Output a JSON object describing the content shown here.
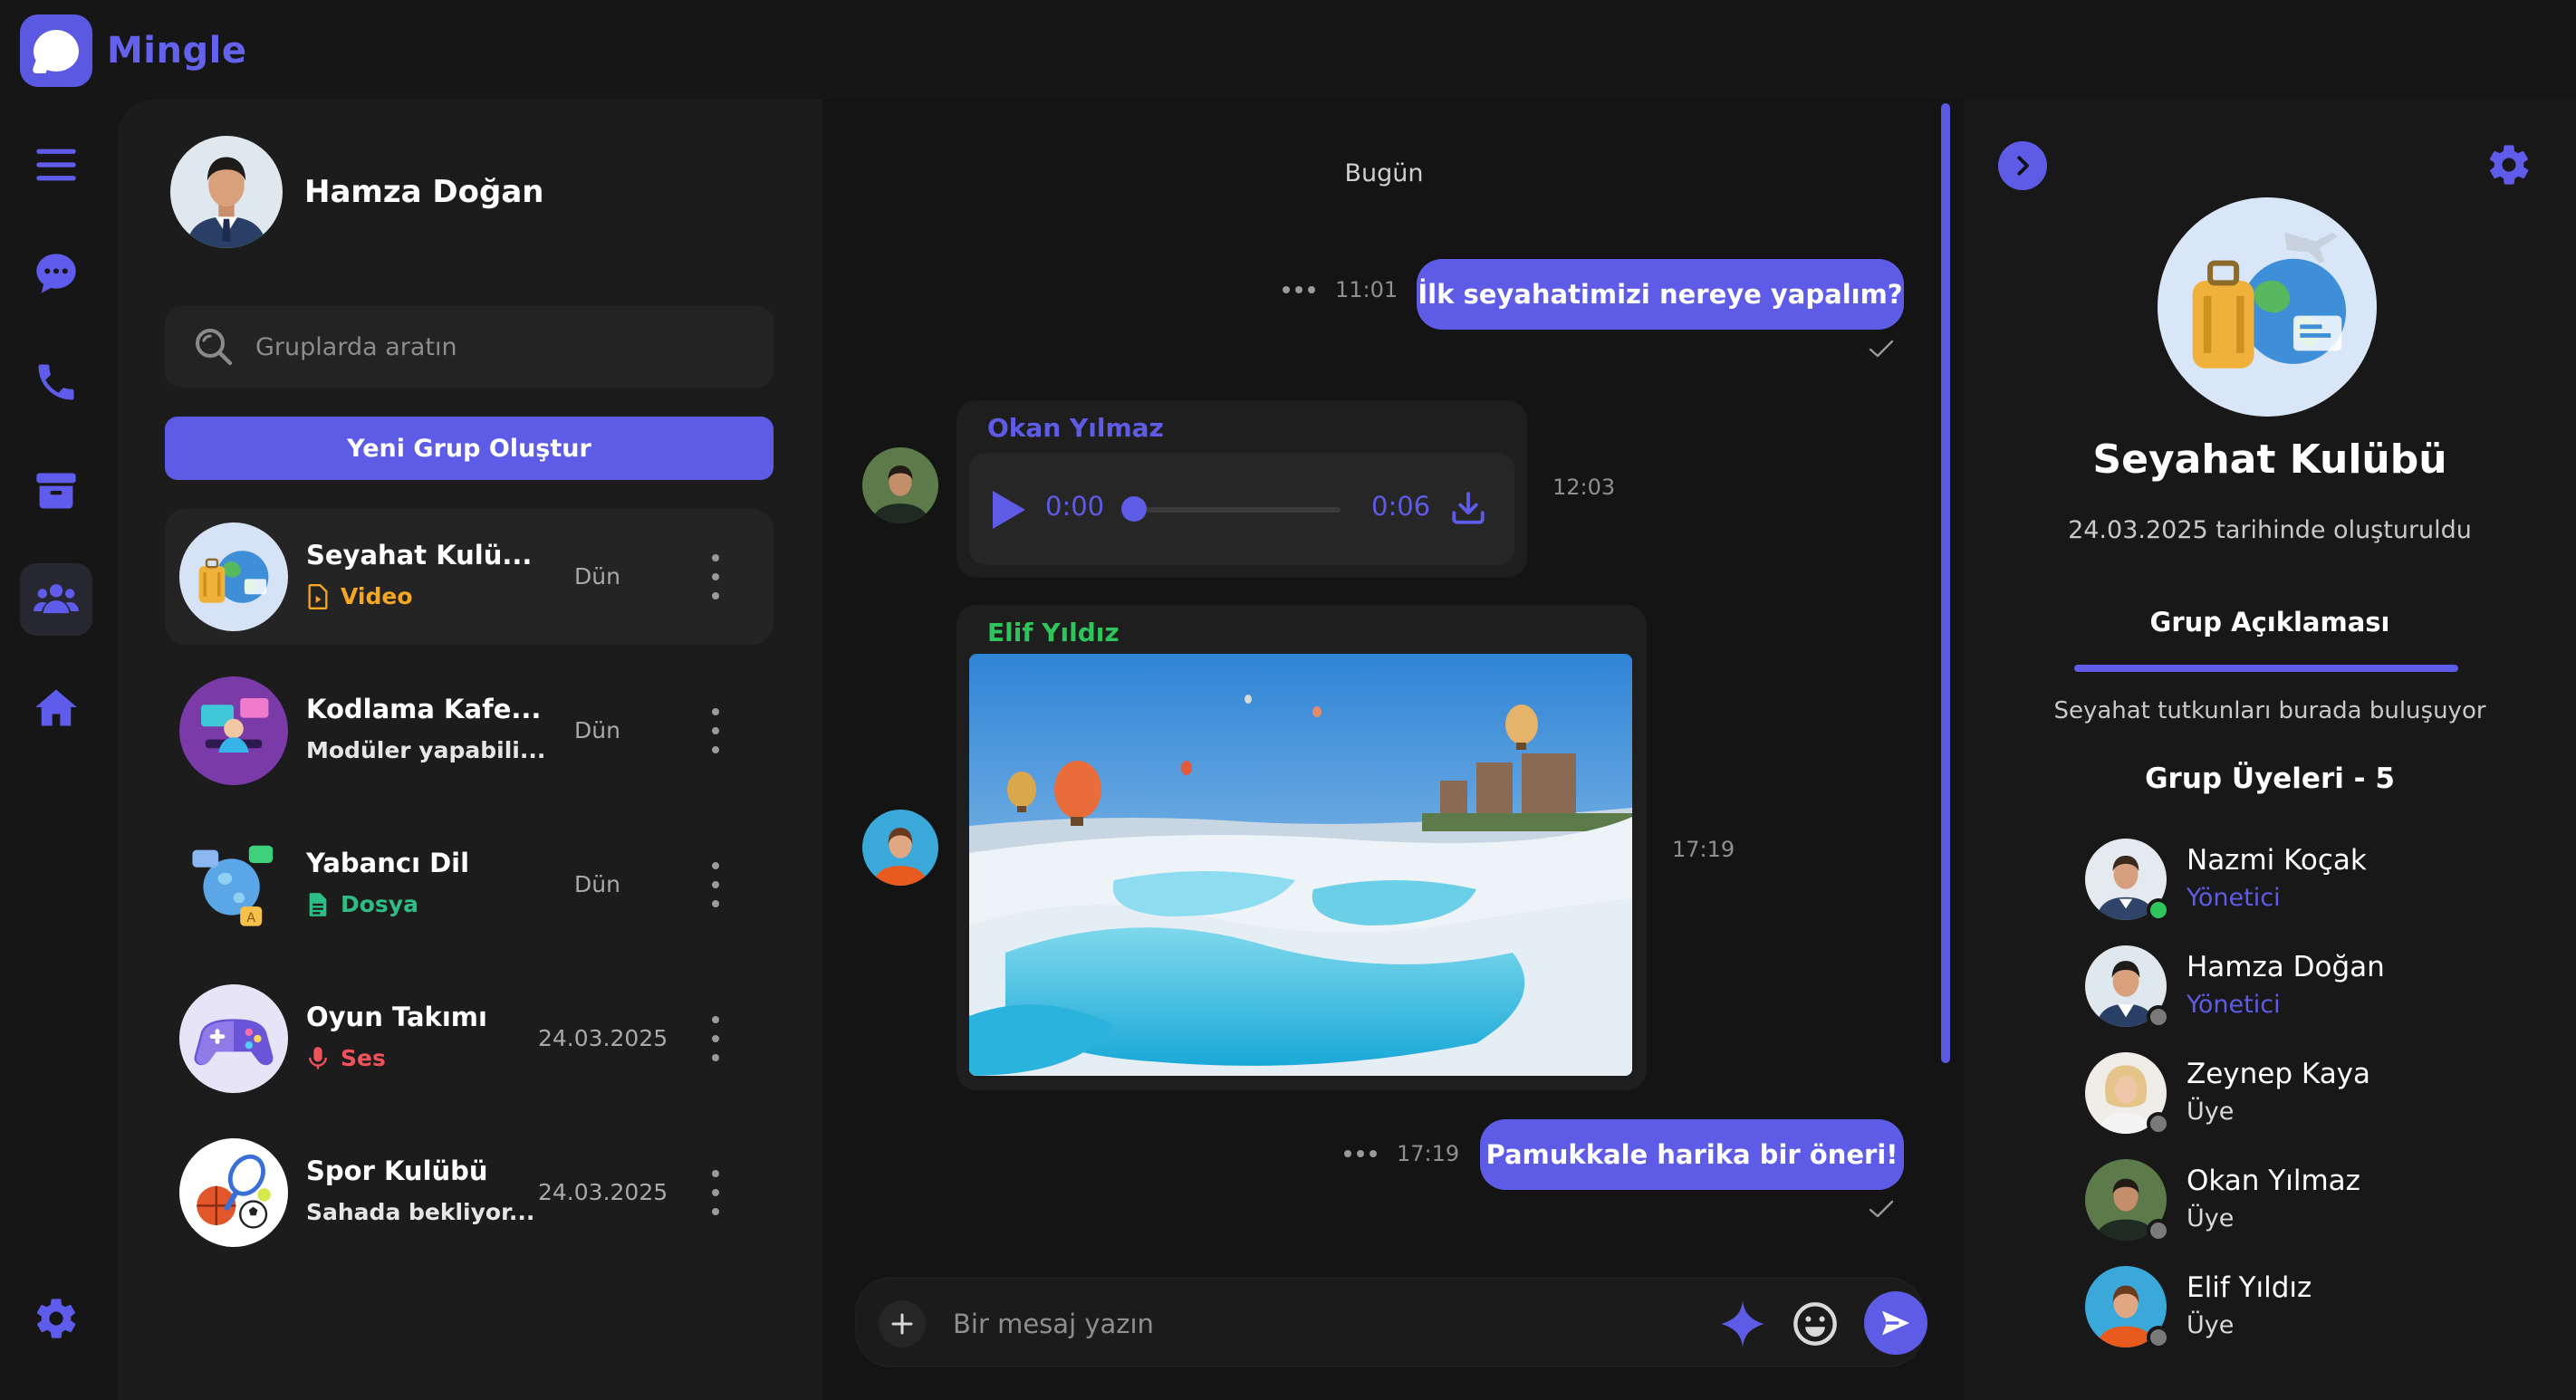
{
  "app": {
    "name": "Mingle",
    "accent": "#5e5ce6"
  },
  "rail": {
    "icons": [
      "menu-icon",
      "chat-icon",
      "phone-icon",
      "archive-icon",
      "groups-icon",
      "home-icon",
      "settings-icon"
    ],
    "active": "groups-icon"
  },
  "user": {
    "name": "Hamza Doğan"
  },
  "search": {
    "placeholder": "Gruplarda aratın"
  },
  "new_group_label": "Yeni Grup Oluştur",
  "groups": [
    {
      "name": "Seyahat Kulü...",
      "sub": "Video",
      "sub_icon": "video-file-icon",
      "sub_color": "#f5a623",
      "time": "Dün",
      "active": true
    },
    {
      "name": "Kodlama Kafe...",
      "sub": "Modüler yapabili...",
      "sub_icon": "",
      "sub_color": "#e6e6e6",
      "time": "Dün",
      "active": false
    },
    {
      "name": "Yabancı Dil",
      "sub": "Dosya",
      "sub_icon": "document-icon",
      "sub_color": "#2ebd85",
      "time": "Dün",
      "active": false
    },
    {
      "name": "Oyun Takımı",
      "sub": "Ses",
      "sub_icon": "microphone-icon",
      "sub_color": "#f0525a",
      "time": "24.03.2025",
      "active": false
    },
    {
      "name": "Spor Kulübü",
      "sub": "Sahada bekliyor...",
      "sub_icon": "",
      "sub_color": "#e6e6e6",
      "time": "24.03.2025",
      "active": false
    }
  ],
  "chat": {
    "day": "Bugün",
    "messages": [
      {
        "type": "out",
        "text": "İlk seyahatimizi nereye yapalım?",
        "time": "11:01"
      },
      {
        "type": "audio",
        "sender": "Okan Yılmaz",
        "sender_color": "#5e5ce6",
        "current": "0:00",
        "duration": "0:06",
        "time": "12:03"
      },
      {
        "type": "image",
        "sender": "Elif Yıldız",
        "sender_color": "#2ec55a",
        "time": "17:19"
      },
      {
        "type": "out",
        "text": "Pamukkale harika bir öneri!",
        "time": "17:19"
      }
    ],
    "composer_placeholder": "Bir mesaj yazın"
  },
  "group_info": {
    "title": "Seyahat Kulübü",
    "created": "24.03.2025 tarihinde oluşturuldu",
    "description_tab": "Grup Açıklaması",
    "description": "Seyahat tutkunları burada buluşuyor",
    "members_title": "Grup Üyeleri - 5",
    "members": [
      {
        "name": "Nazmi Koçak",
        "role": "Yönetici",
        "role_color": "#5e5ce6",
        "online": true
      },
      {
        "name": "Hamza Doğan",
        "role": "Yönetici",
        "role_color": "#5e5ce6",
        "online": false
      },
      {
        "name": "Zeynep Kaya",
        "role": "Üye",
        "role_color": "#d9d9d9",
        "online": false
      },
      {
        "name": "Okan Yılmaz",
        "role": "Üye",
        "role_color": "#d9d9d9",
        "online": false
      },
      {
        "name": "Elif Yıldız",
        "role": "Üye",
        "role_color": "#d9d9d9",
        "online": false
      }
    ]
  }
}
